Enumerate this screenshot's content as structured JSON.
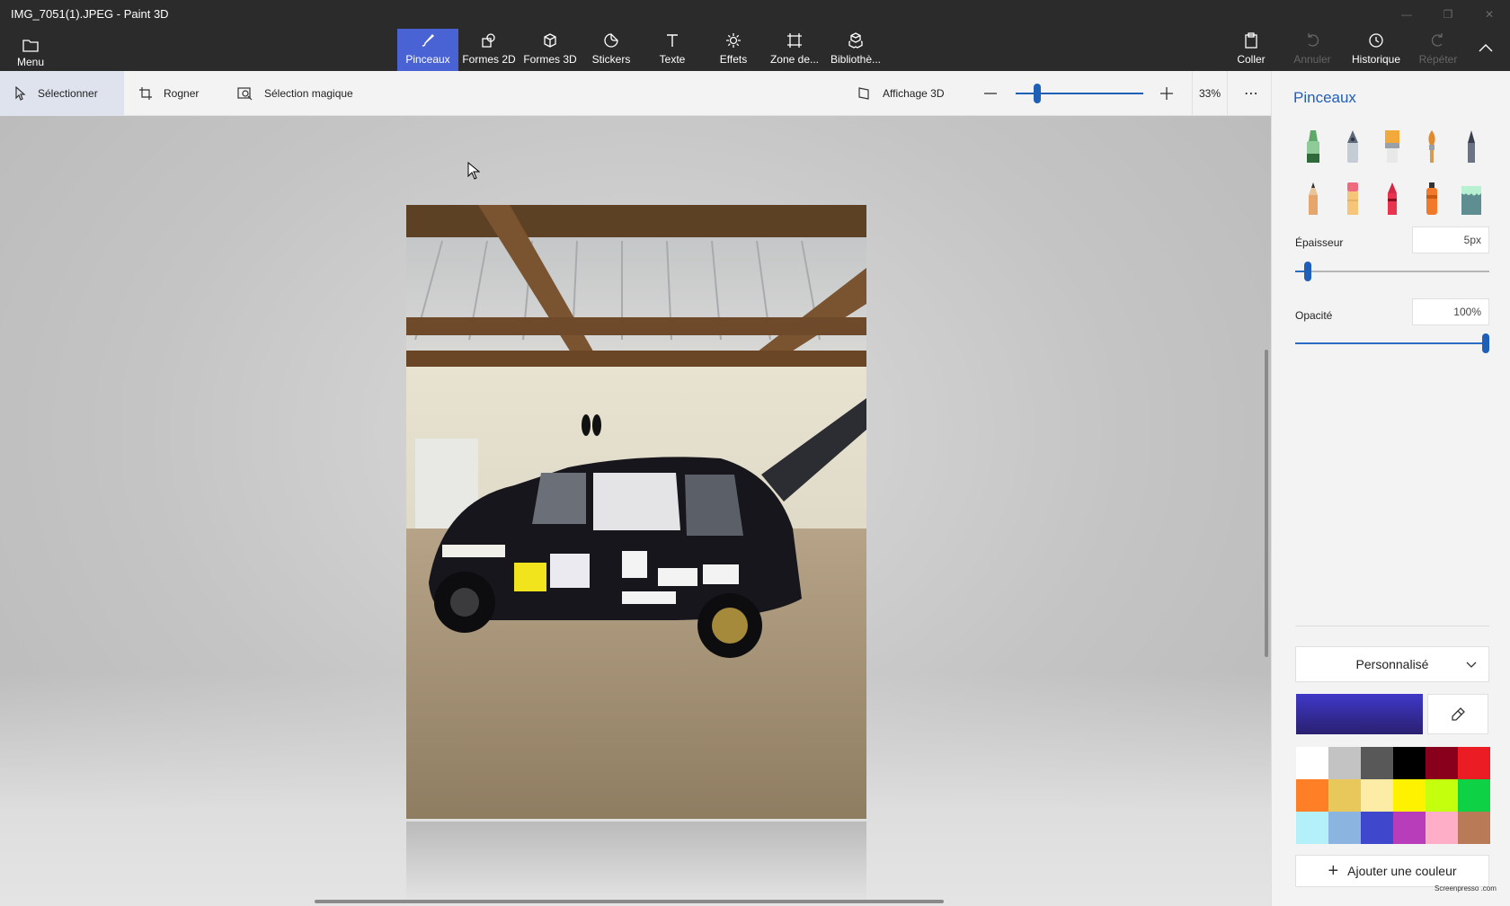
{
  "window": {
    "title": "IMG_7051(1).JPEG - Paint 3D"
  },
  "toolbar": {
    "menu_label": "Menu",
    "tools": [
      {
        "label": "Pinceaux",
        "icon": "brush-icon",
        "active": true
      },
      {
        "label": "Formes 2D",
        "icon": "shapes-2d-icon"
      },
      {
        "label": "Formes 3D",
        "icon": "cube-icon"
      },
      {
        "label": "Stickers",
        "icon": "sticker-icon"
      },
      {
        "label": "Texte",
        "icon": "text-icon"
      },
      {
        "label": "Effets",
        "icon": "sun-icon"
      },
      {
        "label": "Zone de...",
        "icon": "canvas-icon"
      },
      {
        "label": "Bibliothè...",
        "icon": "library-icon"
      }
    ],
    "coller": "Coller",
    "annuler": "Annuler",
    "historique": "Historique",
    "repeter": "Répéter"
  },
  "subbar": {
    "select": "Sélectionner",
    "crop": "Rogner",
    "magic_select": "Sélection magique",
    "view_3d": "Affichage 3D",
    "zoom": "33%",
    "zoom_level": 0.15
  },
  "panel": {
    "title": "Pinceaux",
    "brushes": [
      "marker-icon",
      "calligraphy-pen-icon",
      "oil-brush-icon",
      "watercolor-icon",
      "pixel-pen-icon",
      "pencil-icon",
      "eraser-icon",
      "crayon-icon",
      "spray-can-icon",
      "fill-bucket-icon"
    ],
    "thickness_label": "Épaisseur",
    "thickness_value": "5px",
    "thickness_level": 0.05,
    "opacity_label": "Opacité",
    "opacity_value": "100%",
    "opacity_level": 1.0,
    "color_mode": "Personnalisé",
    "current_color": "#3f38c8",
    "palette": [
      "#ffffff",
      "#c3c3c3",
      "#585858",
      "#000000",
      "#88001b",
      "#ec1c24",
      "#ff7f27",
      "#e8c75b",
      "#fdeca6",
      "#fff200",
      "#c4ff0e",
      "#0ed145",
      "#b4f0fa",
      "#8cb4e0",
      "#3f48cc",
      "#b83dba",
      "#ffaec8",
      "#b97a57"
    ],
    "add_color": "Ajouter une couleur"
  },
  "watermark": "Screenpresso .com"
}
